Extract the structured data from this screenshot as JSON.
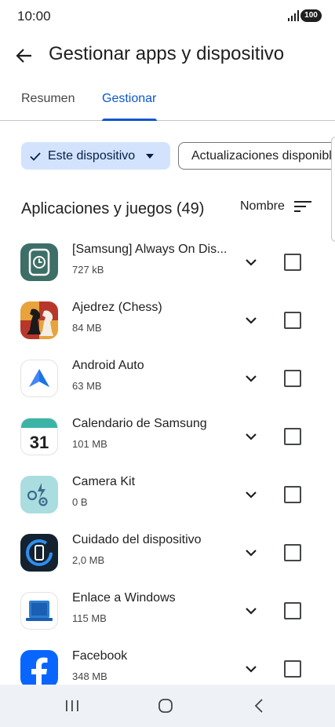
{
  "status": {
    "time": "10:00",
    "battery": "100"
  },
  "header": {
    "title": "Gestionar apps y dispositivo"
  },
  "tabs": [
    {
      "label": "Resumen"
    },
    {
      "label": "Gestionar"
    }
  ],
  "filters": {
    "selected": "Este dispositivo",
    "other": "Actualizaciones disponibles"
  },
  "section": {
    "title": "Aplicaciones y juegos (49)",
    "sort_label": "Nombre"
  },
  "apps": [
    {
      "name": "[Samsung] Always On Dis...",
      "size": "727 kB",
      "icon": "always-on-display-icon"
    },
    {
      "name": "Ajedrez (Chess)",
      "size": "84 MB",
      "icon": "chess-icon"
    },
    {
      "name": "Android Auto",
      "size": "63 MB",
      "icon": "android-auto-icon"
    },
    {
      "name": "Calendario de Samsung",
      "size": "101 MB",
      "icon": "calendar-icon",
      "icon_text": "31"
    },
    {
      "name": "Camera Kit",
      "size": "0 B",
      "icon": "camera-kit-icon"
    },
    {
      "name": "Cuidado del dispositivo",
      "size": "2,0 MB",
      "icon": "device-care-icon"
    },
    {
      "name": "Enlace a Windows",
      "size": "115 MB",
      "icon": "link-to-windows-icon"
    },
    {
      "name": "Facebook",
      "size": "348 MB",
      "icon": "facebook-icon"
    }
  ],
  "colors": {
    "accent": "#0b57d0",
    "chip_selected": "#d3e3fd",
    "nav_bar": "#eef1f6"
  }
}
